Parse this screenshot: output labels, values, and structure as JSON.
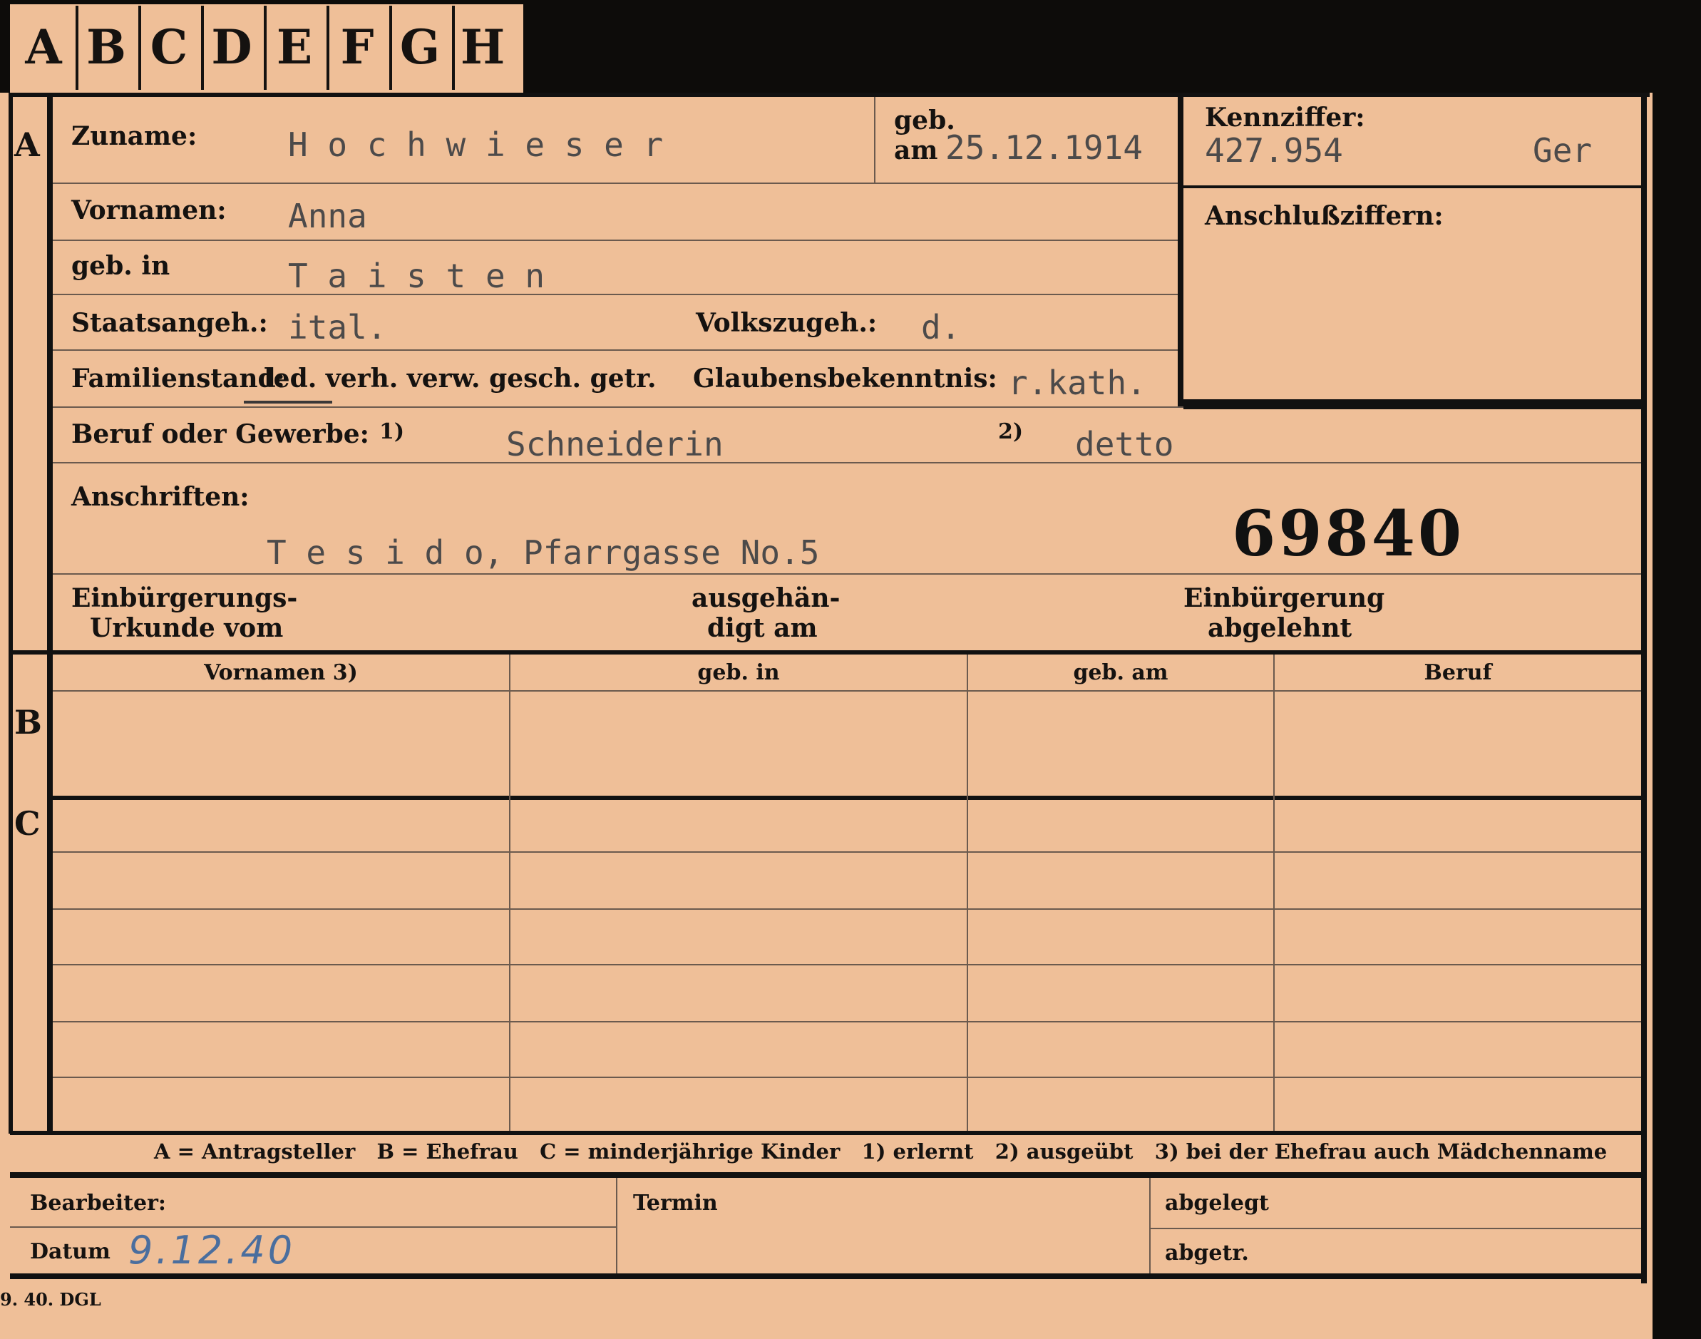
{
  "tabs": [
    "A",
    "B",
    "C",
    "D",
    "E",
    "F",
    "G",
    "H"
  ],
  "sections": {
    "a": "A",
    "b": "B",
    "c": "C"
  },
  "fields": {
    "zuname_label": "Zuname:",
    "zuname_value": "H o c h w i e s e r",
    "geb_label": "geb.",
    "am_label": "am",
    "geb_am_value": "25.12.1914",
    "vornamen_label": "Vornamen:",
    "vornamen_value": "Anna",
    "geb_in_label": "geb. in",
    "geb_in_value": "T a i s t e n",
    "staatsangeh_label": "Staatsangeh.:",
    "staatsangeh_value": "ital.",
    "volkszugeh_label": "Volkszugeh.:",
    "volkszugeh_value": "d.",
    "familienstand_label": "Familienstand:",
    "familienstand_options": "led. verh. verw. gesch. getr.",
    "glaubens_label": "Glaubensbekenntnis:",
    "glaubens_value": "r.kath.",
    "beruf_label": "Beruf oder Gewerbe:",
    "beruf_note1": "1)",
    "beruf_value1": "Schneiderin",
    "beruf_note2": "2)",
    "beruf_value2": "detto",
    "anschriften_label": "Anschriften:",
    "anschriften_value": "T e s i d o, Pfarrgasse No.5",
    "card_number": "69840",
    "einb_urkunde_line1": "Einbürgerungs-",
    "einb_urkunde_line2": "Urkunde vom",
    "ausgehaendigt_line1": "ausgehän-",
    "ausgehaendigt_line2": "digt am",
    "einb_abgelehnt_line1": "Einbürgerung",
    "einb_abgelehnt_line2": "abgelehnt"
  },
  "kennziffer": {
    "label": "Kennziffer:",
    "value": "427.954",
    "suffix": "Ger",
    "anschluss_label": "Anschlußziffern:"
  },
  "table": {
    "headers": [
      "Vornamen 3)",
      "geb. in",
      "geb. am",
      "Beruf"
    ]
  },
  "legend": "A = Antragsteller   B = Ehefrau   C = minderjährige Kinder   1) erlernt   2) ausgeübt   3) bei der Ehefrau auch Mädchenname",
  "footer": {
    "bearbeiter_label": "Bearbeiter:",
    "datum_label": "Datum",
    "datum_value": "9.12.40",
    "termin_label": "Termin",
    "abgelegt_label": "abgelegt",
    "abgetr_label": "abgetr."
  },
  "print_code": "9. 40. DGL",
  "colors": {
    "card": "#efbf98",
    "background": "#0d0c0a",
    "ink": "#151210",
    "typewriter": "#4c4a4a",
    "handwriting": "#4a6e9e"
  }
}
